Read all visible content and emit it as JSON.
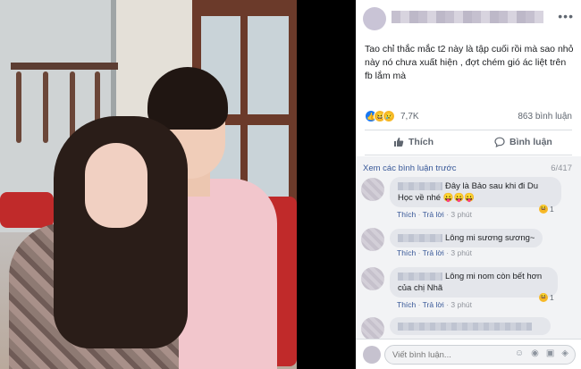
{
  "post": {
    "text": "Tao chỉ thắc mắc t2 này là tập cuối rồi mà sao nhỏ này nó chưa xuất hiện , đợt chém gió ác liệt trên fb lắm mà",
    "reaction_count": "7,7K",
    "comment_count": "863 bình luận",
    "more_glyph": "•••"
  },
  "actions": {
    "like_label": "Thích",
    "comment_label": "Bình luận"
  },
  "comments": {
    "previous_link": "Xem các bình luận trước",
    "page_count": "6/417",
    "items": [
      {
        "text": "Đây là Bảo sau khi đi Du Học về nhé",
        "emoji": "😛😛😛",
        "like": "Thích",
        "reply": "Trả lời",
        "time": "3 phút"
      },
      {
        "text": "Lông mi sương sương~",
        "like": "Thích",
        "reply": "Trả lời",
        "time": "3 phút"
      },
      {
        "text": "Lông mi nom còn bết hơn của chị Nhã",
        "like": "Thích",
        "reply": "Trả lời",
        "time": "3 phút"
      }
    ],
    "reaction_counts": [
      "1",
      "1"
    ],
    "write_placeholder": "Viết bình luận..."
  },
  "colors": {
    "link": "#385898",
    "like_blue": "#1877f2",
    "haha_yellow": "#f7b928"
  }
}
